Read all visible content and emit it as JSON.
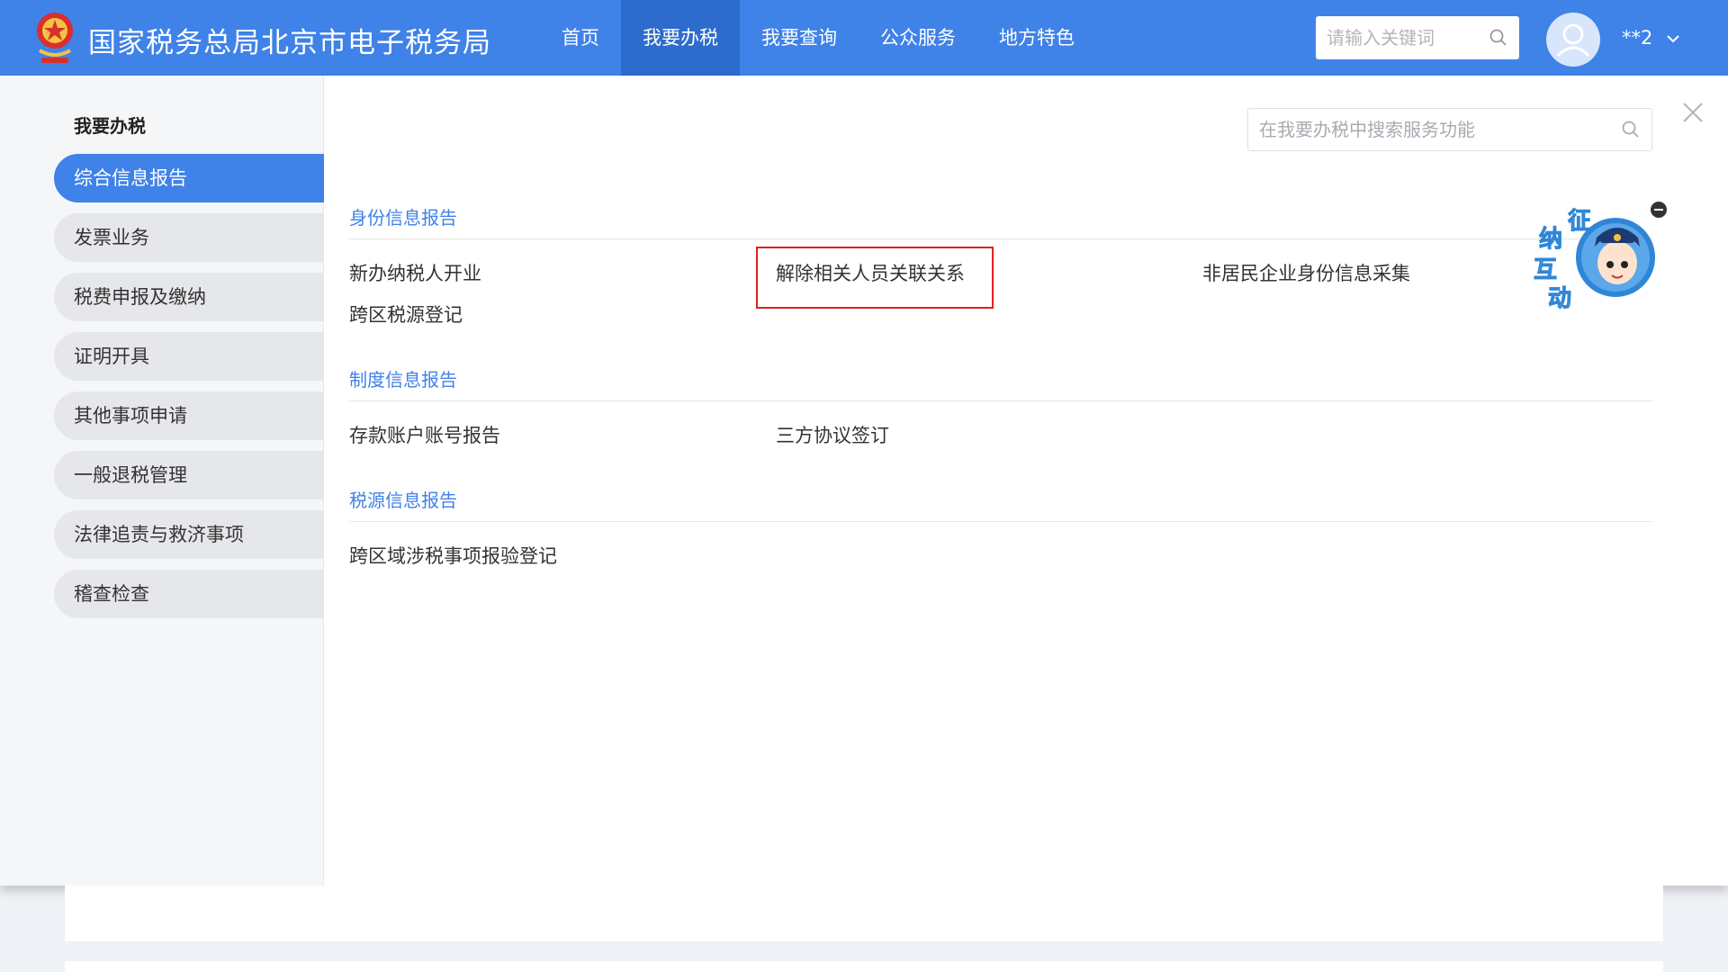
{
  "header": {
    "title": "国家税务总局北京市电子税务局",
    "nav": [
      "首页",
      "我要办税",
      "我要查询",
      "公众服务",
      "地方特色"
    ],
    "search_placeholder": "请输入关键词",
    "user_name": "**2",
    "accent_color": "#3f82e8"
  },
  "sidebar": {
    "heading": "我要办税",
    "items": [
      "综合信息报告",
      "发票业务",
      "税费申报及缴纳",
      "证明开具",
      "其他事项申请",
      "一般退税管理",
      "法律追责与救济事项",
      "稽查检查"
    ]
  },
  "main": {
    "search_placeholder": "在我要办税中搜索服务功能",
    "sections": [
      {
        "title": "身份信息报告",
        "items": [
          "新办纳税人开业",
          "解除相关人员关联关系",
          "非居民企业身份信息采集",
          "跨区税源登记"
        ]
      },
      {
        "title": "制度信息报告",
        "items": [
          "存款账户账号报告",
          "三方协议签订"
        ]
      },
      {
        "title": "税源信息报告",
        "items": [
          "跨区域涉税事项报验登记"
        ]
      }
    ]
  },
  "mascot": {
    "label": [
      "征",
      "纳",
      "互",
      "动"
    ]
  },
  "icons": {
    "logo": "tax-emblem-icon",
    "search": "search-icon",
    "avatar": "user-avatar-icon",
    "chevron": "chevron-down-icon",
    "close": "close-icon"
  }
}
